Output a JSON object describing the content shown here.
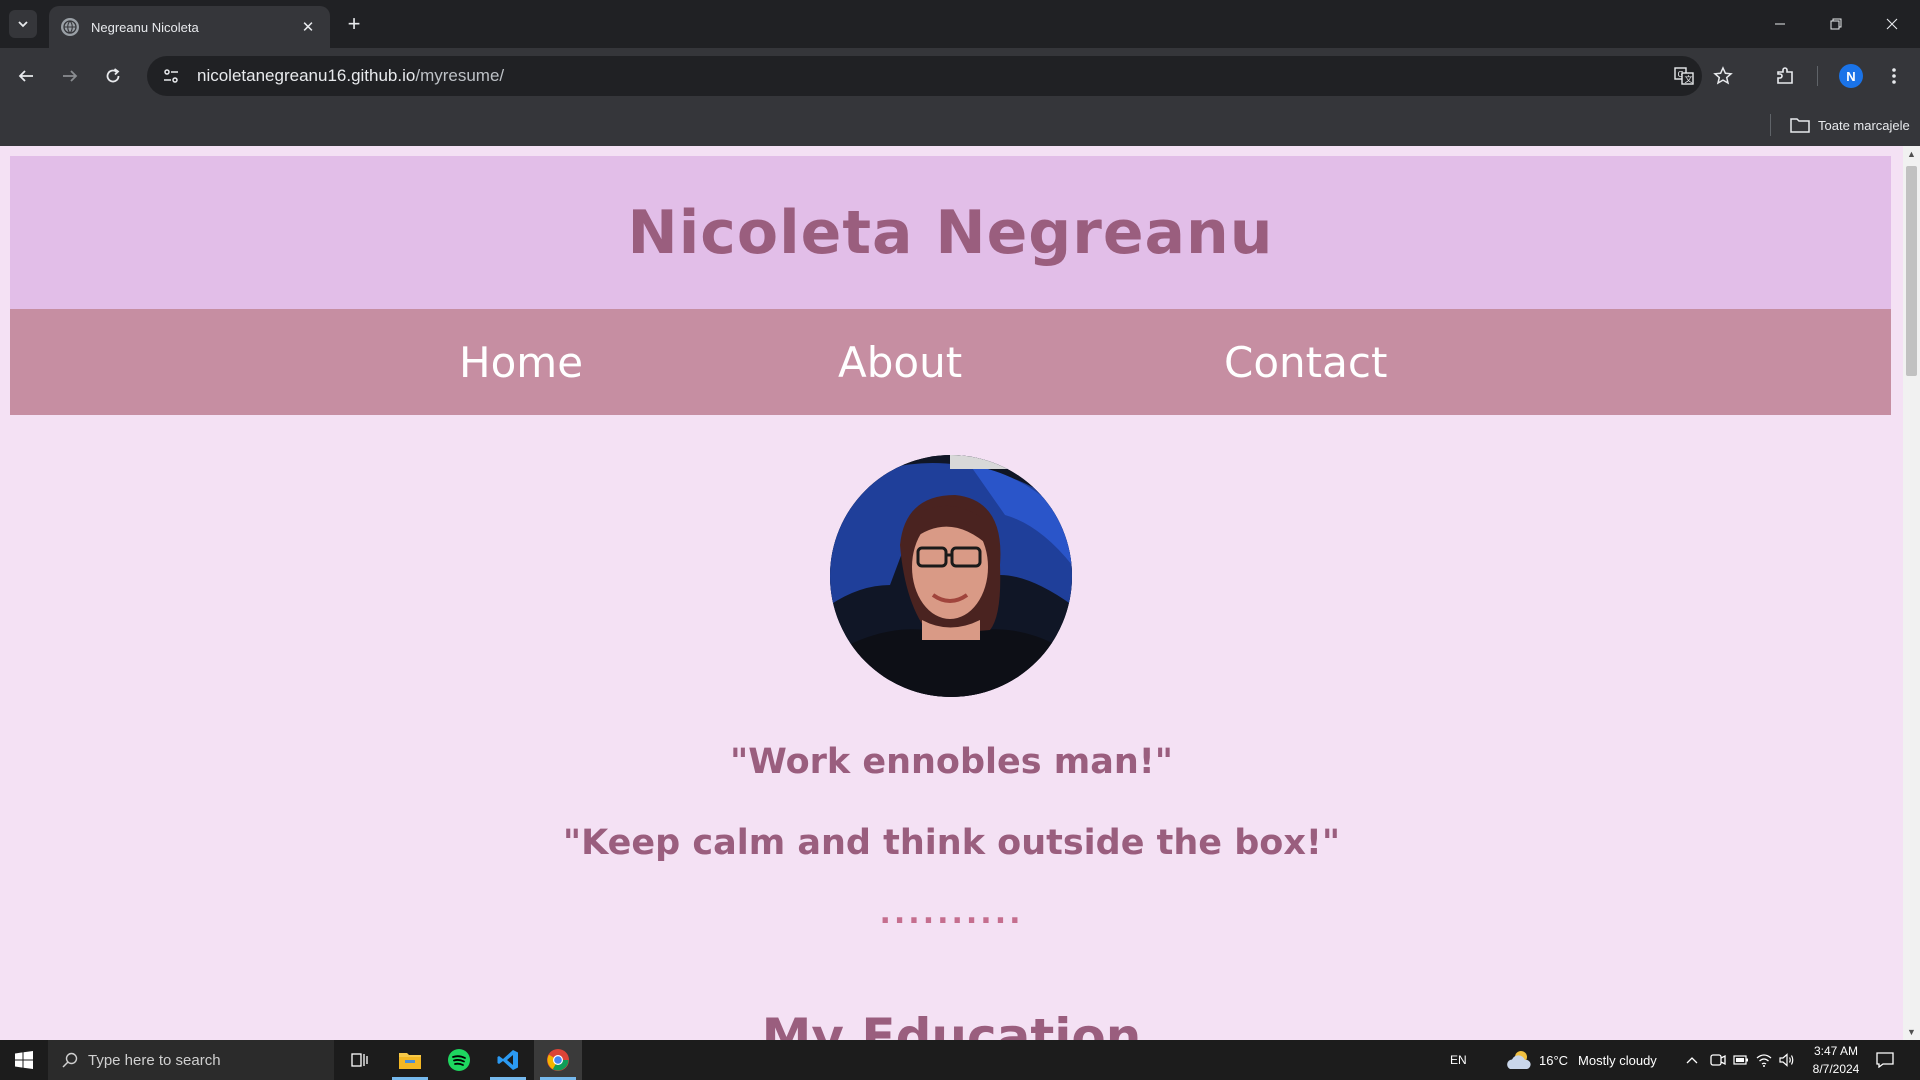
{
  "browser": {
    "tab": {
      "title": "Negreanu Nicoleta"
    },
    "address": {
      "host": "nicoletanegreanu16.github.io",
      "path": "/myresume/"
    },
    "bookmarks": {
      "all_label": "Toate marcajele"
    },
    "profile_initial": "N"
  },
  "site": {
    "title": "Nicoleta Negreanu",
    "nav": [
      {
        "label": "Home"
      },
      {
        "label": "About"
      },
      {
        "label": "Contact"
      }
    ],
    "quotes": [
      "\"Work ennobles man!\"",
      "\"Keep calm and think outside the box!\""
    ],
    "divider": "..........",
    "section_heading": "My Education"
  },
  "taskbar": {
    "search_placeholder": "Type here to search",
    "language": "EN",
    "weather": {
      "temp": "16°C",
      "condition": "Mostly cloudy"
    },
    "clock": {
      "time": "3:47 AM",
      "date": "8/7/2024"
    }
  }
}
